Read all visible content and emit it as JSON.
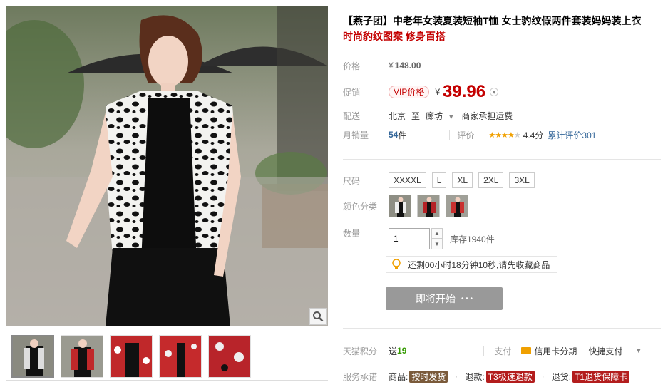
{
  "title": {
    "line1": "【燕子团】中老年女装夏装短袖T恤 女士豹纹假两件套装妈妈装上衣",
    "line2": "时尚豹纹图案 修身百搭"
  },
  "price": {
    "label": "价格",
    "currency": "¥",
    "original": "148.00"
  },
  "promo": {
    "label": "促销",
    "vip_tag": "VIP价格",
    "currency": "¥",
    "value": "39.96"
  },
  "shipping": {
    "label": "配送",
    "from": "北京",
    "to_word": "至",
    "to": "廊坊",
    "fee": "商家承担运费"
  },
  "sales": {
    "label": "月销量",
    "count": "54",
    "unit": "件",
    "rating_label": "评价",
    "score": "4.4分",
    "reviews": "累计评价301",
    "stars": 4.4
  },
  "size": {
    "label": "尺码",
    "options": [
      "XXXXL",
      "L",
      "XL",
      "2XL",
      "3XL"
    ]
  },
  "color": {
    "label": "颜色分类",
    "swatches": [
      "black-white",
      "red-print-a",
      "red-print-b"
    ]
  },
  "quantity": {
    "label": "数量",
    "value": "1",
    "stock": "库存1940件"
  },
  "notice": {
    "text": "还剩00小时18分钟10秒,请先收藏商品"
  },
  "buy_button": {
    "label": "即将开始",
    "dots": "• • •"
  },
  "points": {
    "label": "天猫积分",
    "prefix": "送",
    "value": "19"
  },
  "payment": {
    "label": "支付",
    "credit": "信用卡分期",
    "quick": "快捷支付"
  },
  "service": {
    "label": "服务承诺",
    "goods_label": "商品:",
    "goods_badge": "按时发货",
    "refund_label": "退款:",
    "refund_badge": "T3极速退款",
    "return_label": "退货:",
    "return_badge": "T1退货保障卡"
  },
  "colors": {
    "accent": "#c40000",
    "link": "#336699",
    "green": "#339900",
    "button": "#999999",
    "badge": "#7a5a3a",
    "badge_red": "#b31d1d"
  },
  "icons": [
    "magnifier-icon",
    "lightbulb-icon",
    "credit-card-icon",
    "chevron-down-icon",
    "star-icon"
  ]
}
